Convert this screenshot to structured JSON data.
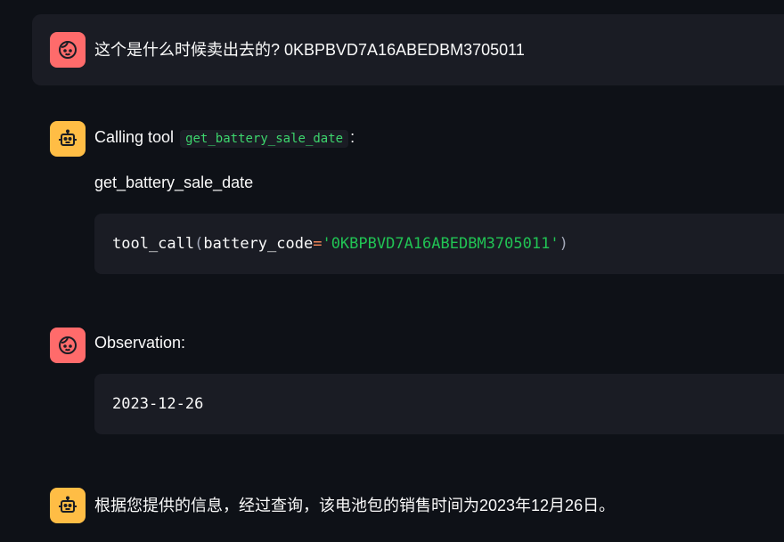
{
  "messages": [
    {
      "role": "user",
      "avatar": "face-icon",
      "text": "这个是什么时候卖出去的? 0KBPBVD7A16ABEDBM3705011"
    },
    {
      "role": "assistant",
      "avatar": "robot-icon",
      "prefix": "Calling tool",
      "tool_name": "get_battery_sale_date",
      "suffix": ":",
      "subtitle": "get_battery_sale_date",
      "code": {
        "fn": "tool_call",
        "open": "(",
        "arg": "battery_code",
        "op": "=",
        "value": "'0KBPBVD7A16ABEDBM3705011'",
        "close": ")"
      }
    },
    {
      "role": "user",
      "avatar": "face-icon",
      "text": "Observation:",
      "code": "2023-12-26"
    },
    {
      "role": "assistant",
      "avatar": "robot-icon",
      "text": "根据您提供的信息，经过查询，该电池包的销售时间为2023年12月26日。"
    }
  ],
  "colors": {
    "background": "#0e1117",
    "user_avatar": "#ff6b6b",
    "assistant_avatar": "#ffbd45",
    "message_bg": "#1a1c24",
    "code_string": "#21c354"
  }
}
